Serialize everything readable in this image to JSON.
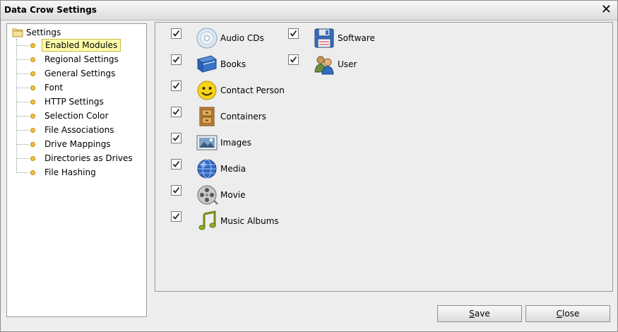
{
  "window": {
    "title": "Data Crow Settings"
  },
  "tree": {
    "root_label": "Settings",
    "items": [
      {
        "label": "Enabled Modules",
        "selected": true
      },
      {
        "label": "Regional Settings"
      },
      {
        "label": "General Settings"
      },
      {
        "label": "Font"
      },
      {
        "label": "HTTP Settings"
      },
      {
        "label": "Selection Color"
      },
      {
        "label": "File Associations"
      },
      {
        "label": "Drive Mappings"
      },
      {
        "label": "Directories as Drives"
      },
      {
        "label": "File Hashing"
      }
    ]
  },
  "modules": [
    {
      "label": "Audio CDs",
      "icon": "cd-icon",
      "checked": true
    },
    {
      "label": "Books",
      "icon": "book-icon",
      "checked": true
    },
    {
      "label": "Contact Person",
      "icon": "smiley-icon",
      "checked": true
    },
    {
      "label": "Containers",
      "icon": "cabinet-icon",
      "checked": true
    },
    {
      "label": "Images",
      "icon": "image-icon",
      "checked": true
    },
    {
      "label": "Media",
      "icon": "globe-icon",
      "checked": true
    },
    {
      "label": "Movie",
      "icon": "film-reel-icon",
      "checked": true
    },
    {
      "label": "Music Albums",
      "icon": "music-note-icon",
      "checked": true
    },
    {
      "label": "Software",
      "icon": "floppy-disk-icon",
      "checked": true
    },
    {
      "label": "User",
      "icon": "users-icon",
      "checked": true
    }
  ],
  "buttons": {
    "save": {
      "mnemonic": "S",
      "rest": "ave"
    },
    "close": {
      "mnemonic": "C",
      "rest": "lose"
    }
  }
}
